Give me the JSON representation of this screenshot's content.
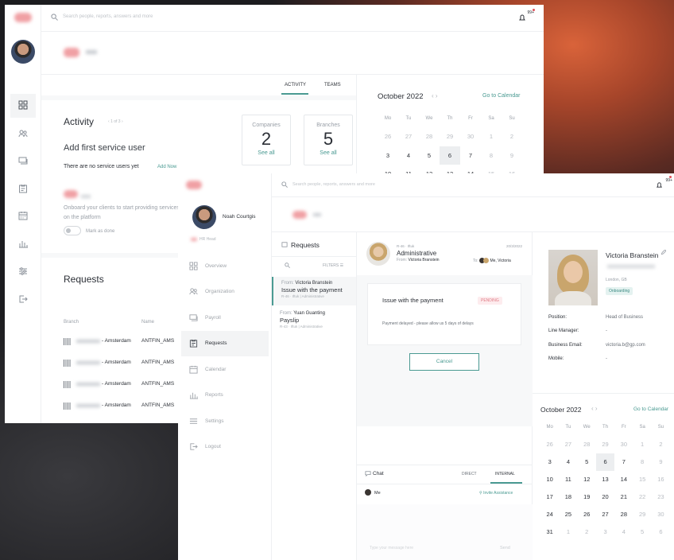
{
  "back": {
    "search": {
      "placeholder": "Search people, reports, answers and more"
    },
    "notif_count": "99+",
    "tabs": [
      "ACTIVITY",
      "TEAMS"
    ],
    "activity": {
      "title": "Activity",
      "pager": "1 of 3",
      "heading": "Add first service user",
      "empty_text": "There are no service users yet",
      "add_now": "Add Now",
      "onboard_text": "Onboard your clients to start providing services on the platform",
      "mark_done": "Mark as done"
    },
    "stats": [
      {
        "label": "Companies",
        "value": "2",
        "link": "See all"
      },
      {
        "label": "Branches",
        "value": "5",
        "link": "See all"
      }
    ],
    "requests": {
      "title": "Requests",
      "columns": [
        "Branch",
        "Name"
      ],
      "rows": [
        {
          "branch": "- Amsterdam",
          "name": "ANTFIN_AMS"
        },
        {
          "branch": "- Amsterdam",
          "name": "ANTFIN_AMS"
        },
        {
          "branch": "- Amsterdam",
          "name": "ANTFIN_AMS"
        },
        {
          "branch": "- Amsterdam",
          "name": "ANTFIN_AMS"
        }
      ]
    },
    "calendar": {
      "month": "October 2022",
      "go_link": "Go to Calendar",
      "dows": [
        "Mo",
        "Tu",
        "We",
        "Th",
        "Fr",
        "Sa",
        "Su"
      ],
      "weeks": [
        [
          "26",
          "27",
          "28",
          "29",
          "30",
          "1",
          "2"
        ],
        [
          "3",
          "4",
          "5",
          "6",
          "7",
          "8",
          "9"
        ],
        [
          "10",
          "11",
          "12",
          "13",
          "14",
          "15",
          "16"
        ]
      ]
    }
  },
  "front": {
    "search": {
      "placeholder": "Search people, reports, answers and more"
    },
    "notif_count": "99+",
    "user": {
      "name": "Noah Courtgis",
      "role": "HR Head"
    },
    "nav": [
      "Overview",
      "Organization",
      "Payroll",
      "Requests",
      "Calendar",
      "Reports",
      "Settings",
      "Logout"
    ],
    "nav_active": "Requests",
    "requests_title": "Requests",
    "filters": "FILTERS",
    "request_items": [
      {
        "from_label": "From:",
        "from": "Victoria Branstein",
        "title": "Issue with the payment",
        "meta": "R-46 · Iftuk | Administrative"
      },
      {
        "from_label": "From:",
        "from": "Yuan Guanting",
        "title": "Payslip",
        "meta": "R-43 · Iftuk | Administrative"
      }
    ],
    "detail": {
      "code": "R-46 · Iftuk",
      "date": "20/3/2022",
      "category": "Administrative",
      "from_label": "From:",
      "from": "Victoria Branstein",
      "to_label": "To:",
      "to": "Me, Victoria",
      "issue_title": "Issue with the payment",
      "status": "PENDING",
      "message": "Payment delayed - please allow us 5 days of delays",
      "cancel": "Cancel"
    },
    "chat": {
      "title": "Chat",
      "tabs": [
        "DIRECT",
        "INTERNAL"
      ],
      "me": "Me",
      "invite": "Invite Assistance",
      "input_placeholder": "Type your message here",
      "send": "Send"
    },
    "profile": {
      "name": "Victoria Branstein",
      "location": "London, GB",
      "tag": "Onboarding",
      "fields": [
        {
          "label": "Position:",
          "value": "Head of Business"
        },
        {
          "label": "Line Manager:",
          "value": "-"
        },
        {
          "label": "Business Email:",
          "value": "victoria.b@gp.com"
        },
        {
          "label": "Mobile:",
          "value": "-"
        }
      ]
    },
    "calendar": {
      "month": "October 2022",
      "go_link": "Go to Calendar",
      "dows": [
        "Mo",
        "Tu",
        "We",
        "Th",
        "Fr",
        "Sa",
        "Su"
      ],
      "weeks": [
        [
          "26",
          "27",
          "28",
          "29",
          "30",
          "1",
          "2"
        ],
        [
          "3",
          "4",
          "5",
          "6",
          "7",
          "8",
          "9"
        ],
        [
          "10",
          "11",
          "12",
          "13",
          "14",
          "15",
          "16"
        ],
        [
          "17",
          "18",
          "19",
          "20",
          "21",
          "22",
          "23"
        ],
        [
          "24",
          "25",
          "26",
          "27",
          "28",
          "29",
          "30"
        ],
        [
          "31",
          "1",
          "2",
          "3",
          "4",
          "5",
          "6"
        ]
      ],
      "today": "6"
    }
  }
}
